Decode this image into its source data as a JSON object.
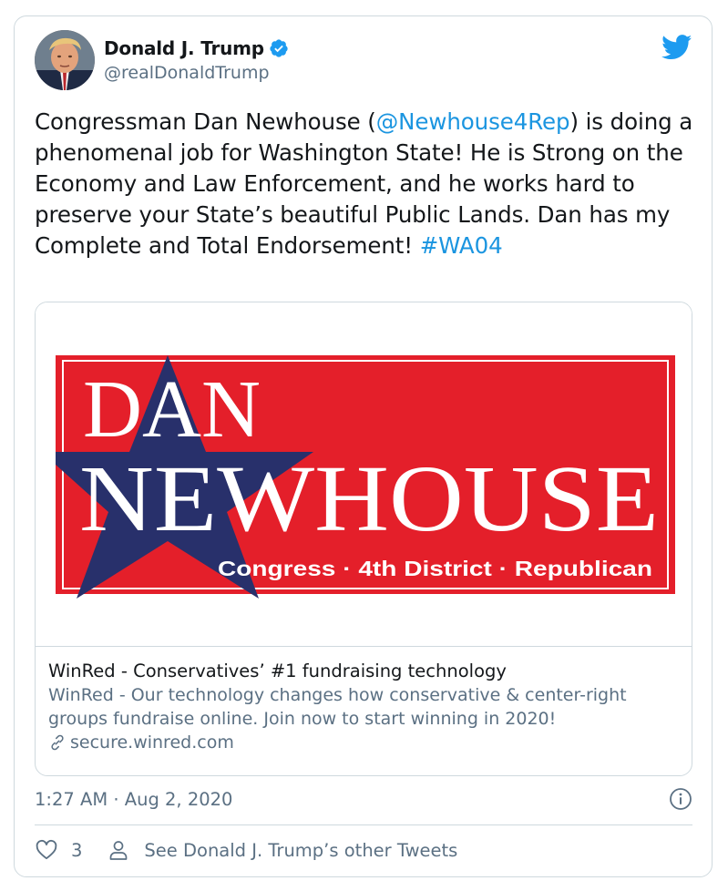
{
  "author": {
    "display_name": "Donald J. Trump",
    "handle": "@realDonaldTrump",
    "verified": true
  },
  "tweet": {
    "text_before_mention": "Congressman Dan Newhouse (",
    "mention": "@Newhouse4Rep",
    "text_after_mention": ") is doing a phenomenal job for Washington State! He is Strong on the Economy and Law Enforcement, and he works hard to preserve your State’s beautiful Public Lands. Dan has my Complete and Total Endorsement! ",
    "hashtag": "#WA04"
  },
  "card": {
    "banner_line1": "DAN",
    "banner_line2": "NEWHOUSE",
    "banner_tagline": "Congress · 4th District · Republican",
    "title": "WinRed - Conservatives’ #1 fundraising technology",
    "description": "WinRed - Our technology changes how conservative & center-right groups fundraise online. Join now to start winning in 2020!",
    "domain": "secure.winred.com"
  },
  "meta": {
    "timestamp": "1:27 AM · Aug 2, 2020",
    "like_count": "3",
    "see_other_label": "See Donald J. Trump’s other Tweets"
  },
  "colors": {
    "link_blue": "#1b95e0",
    "banner_red": "#e41f2a",
    "banner_navy": "#28306b",
    "secondary_text": "#5b7083",
    "border": "#cfd9de"
  },
  "icons": {
    "verified": "verified-badge-icon",
    "brand": "twitter-bird-icon",
    "link": "link-chain-icon",
    "info": "info-circle-icon",
    "like": "heart-outline-icon",
    "profile": "person-outline-icon"
  }
}
